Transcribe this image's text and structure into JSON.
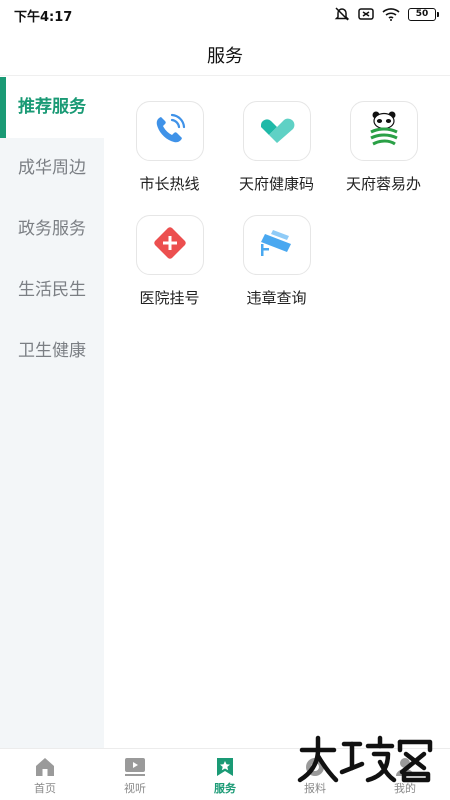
{
  "status_bar": {
    "time": "下午4:17",
    "battery": "50",
    "icons": [
      "mute-icon",
      "sim-icon",
      "wifi-icon",
      "battery-icon"
    ]
  },
  "header": {
    "title": "服务"
  },
  "sidebar": {
    "active_color": "#1a9a75",
    "items": [
      {
        "label": "推荐服务",
        "active": true
      },
      {
        "label": "成华周边",
        "active": false
      },
      {
        "label": "政务服务",
        "active": false
      },
      {
        "label": "生活民生",
        "active": false
      },
      {
        "label": "卫生健康",
        "active": false
      }
    ]
  },
  "services": [
    {
      "label": "市长热线",
      "icon": "phone-icon"
    },
    {
      "label": "天府健康码",
      "icon": "heart-icon"
    },
    {
      "label": "天府蓉易办",
      "icon": "panda-icon"
    },
    {
      "label": "医院挂号",
      "icon": "medical-cross-icon"
    },
    {
      "label": "违章查询",
      "icon": "camera-icon"
    }
  ],
  "tabbar": {
    "active_color": "#1a9a75",
    "items": [
      {
        "label": "首页",
        "icon": "home-icon",
        "active": false
      },
      {
        "label": "视听",
        "icon": "video-icon",
        "active": false
      },
      {
        "label": "服务",
        "icon": "bookmark-star-icon",
        "active": true
      },
      {
        "label": "报料",
        "icon": "report-icon",
        "active": false
      },
      {
        "label": "我的",
        "icon": "user-icon",
        "active": false
      }
    ]
  }
}
